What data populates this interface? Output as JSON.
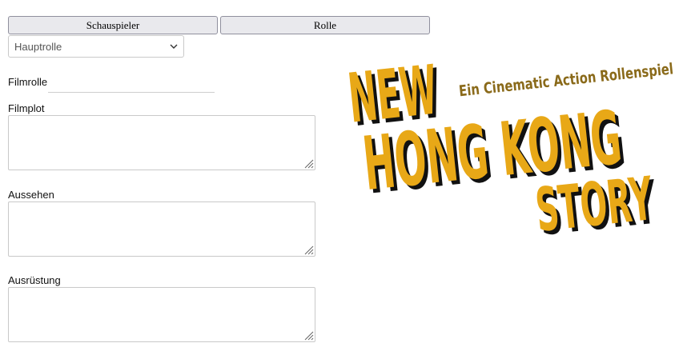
{
  "tabs": {
    "schauspieler_label": "Schauspieler",
    "rolle_label": "Rolle"
  },
  "role_select": {
    "selected": "Hauptrolle"
  },
  "fields": {
    "filmrolle_label": "Filmrolle",
    "filmrolle_value": "",
    "filmplot_label": "Filmplot",
    "aussehen_label": "Aussehen",
    "ausruestung_label": "Ausrüstung"
  },
  "logo": {
    "line1": "NEW",
    "line2": "HONG KONG",
    "line3": "STORY",
    "tagline": "Ein Cinematic Action Rollenspiel",
    "color_primary": "#e8a817",
    "color_shadow": "#111111",
    "color_tagline": "#8a6a1a"
  },
  "icons": {
    "select_arrow": "chevron-down-icon",
    "textarea_resize": "resize-grip-icon"
  }
}
